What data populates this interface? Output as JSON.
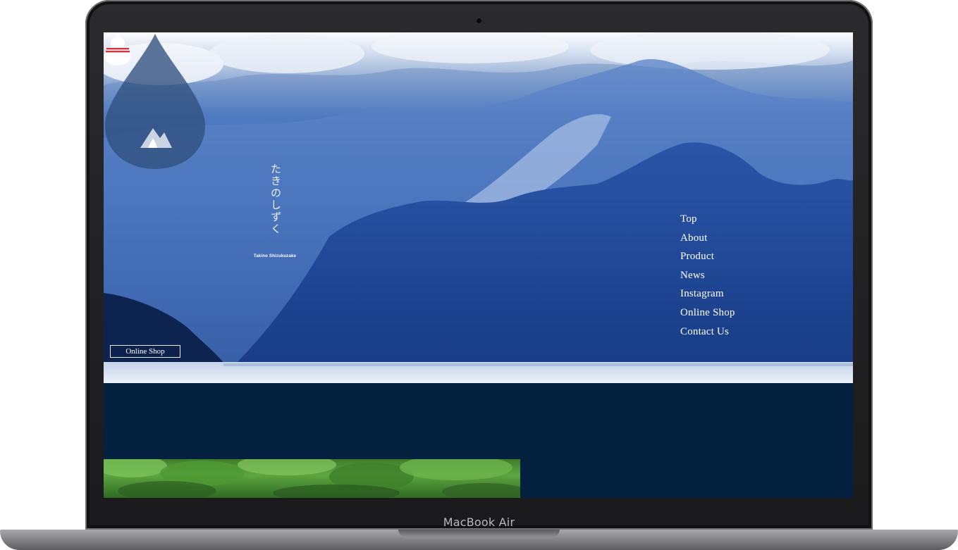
{
  "device": {
    "label": "MacBook Air"
  },
  "site": {
    "logo_text": "たきのしずく",
    "logo_subtitle": "Takino Shizukuzake",
    "online_shop_button": "Online Shop",
    "nav_items": [
      "Top",
      "About",
      "Product",
      "News",
      "Instagram",
      "Online Shop",
      "Contact Us"
    ]
  },
  "colors": {
    "dark_navy": "#03213f",
    "drop_fill": "#2f4f7d",
    "gourd_red": "#d8333a"
  },
  "icons": {
    "brand_mark": "mountain-icon",
    "top_right": "gourd-icon"
  }
}
